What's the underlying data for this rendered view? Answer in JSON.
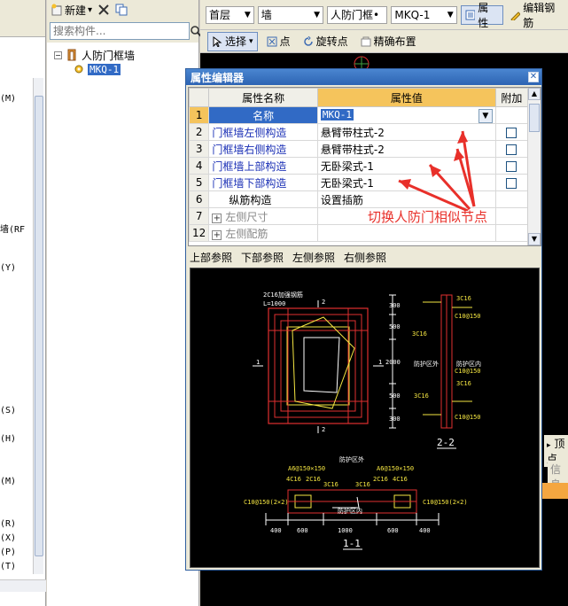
{
  "left_panel": {
    "fragments": [
      "(M)",
      "墙(RF",
      "(Y)",
      "(S)",
      "(H)",
      "(M)",
      "(R)",
      "(X)",
      "(P)",
      "(T)"
    ]
  },
  "tree_panel": {
    "toolbar": {
      "new_label": "新建",
      "new_arrow": "▾"
    },
    "search": {
      "placeholder": "搜索构件..."
    },
    "tree": {
      "root_label": "人防门框墙",
      "root_expander": "−",
      "child_label": "MKQ-1"
    }
  },
  "main_toolbar": {
    "floor": "首层",
    "category": "墙",
    "subcategory": "人防门框•",
    "component": "MKQ-1",
    "properties_btn": "属性",
    "edit_rebar_btn": "编辑钢筋"
  },
  "draw_toolbar": {
    "select": "选择",
    "point": "点",
    "rotate_point": "旋转点",
    "precise_place": "精确布置"
  },
  "right_fragments": {
    "a": "顶点",
    "b": "信息"
  },
  "dialog": {
    "title": "属性编辑器",
    "close": "✕",
    "columns": {
      "name": "属性名称",
      "value": "属性值",
      "attach": "附加"
    },
    "rows": [
      {
        "num": "1",
        "name": "名称",
        "value": "MKQ-1"
      },
      {
        "num": "2",
        "name": "门框墙左侧构造",
        "value": "悬臂带柱式-2"
      },
      {
        "num": "3",
        "name": "门框墙右侧构造",
        "value": "悬臂带柱式-2"
      },
      {
        "num": "4",
        "name": "门框墙上部构造",
        "value": "无卧梁式-1"
      },
      {
        "num": "5",
        "name": "门框墙下部构造",
        "value": "无卧梁式-1"
      },
      {
        "num": "6",
        "name": "纵筋构造",
        "value": "设置插筋"
      },
      {
        "num": "7",
        "name": "左侧尺寸",
        "value": ""
      },
      {
        "num": "12",
        "name": "左侧配筋",
        "value": ""
      }
    ],
    "annotation": "切换人防门相似节点",
    "ref_tabs": [
      "上部参照",
      "下部参照",
      "左侧参照",
      "右侧参照"
    ]
  },
  "preview": {
    "label_1_1": "1-1",
    "label_2_2": "2-2",
    "plan_notes": [
      "2C16加强钢筋",
      "L=1000"
    ],
    "section_dims": [
      "300",
      "500",
      "2000",
      "500",
      "300"
    ],
    "section_rebar": [
      "3C16",
      "C10@150",
      "3C16",
      "C10@150",
      "3C16",
      "3C16",
      "C10@150"
    ],
    "section_marks": [
      "防护区外",
      "防护区内"
    ],
    "bottom_rebar_left": [
      "A6@150×150",
      "4C16",
      "2C16",
      "3C16"
    ],
    "bottom_rebar_right": [
      "A6@150×150",
      "2C16",
      "4C16",
      "3C16"
    ],
    "bottom_side": [
      "C10@150(2×2)",
      "C10@150(2×2)"
    ],
    "bottom_note_top": "防护区外",
    "bottom_note_mid": "防护区内",
    "bottom_dims": [
      "400",
      "600",
      "1000",
      "600",
      "400"
    ]
  }
}
